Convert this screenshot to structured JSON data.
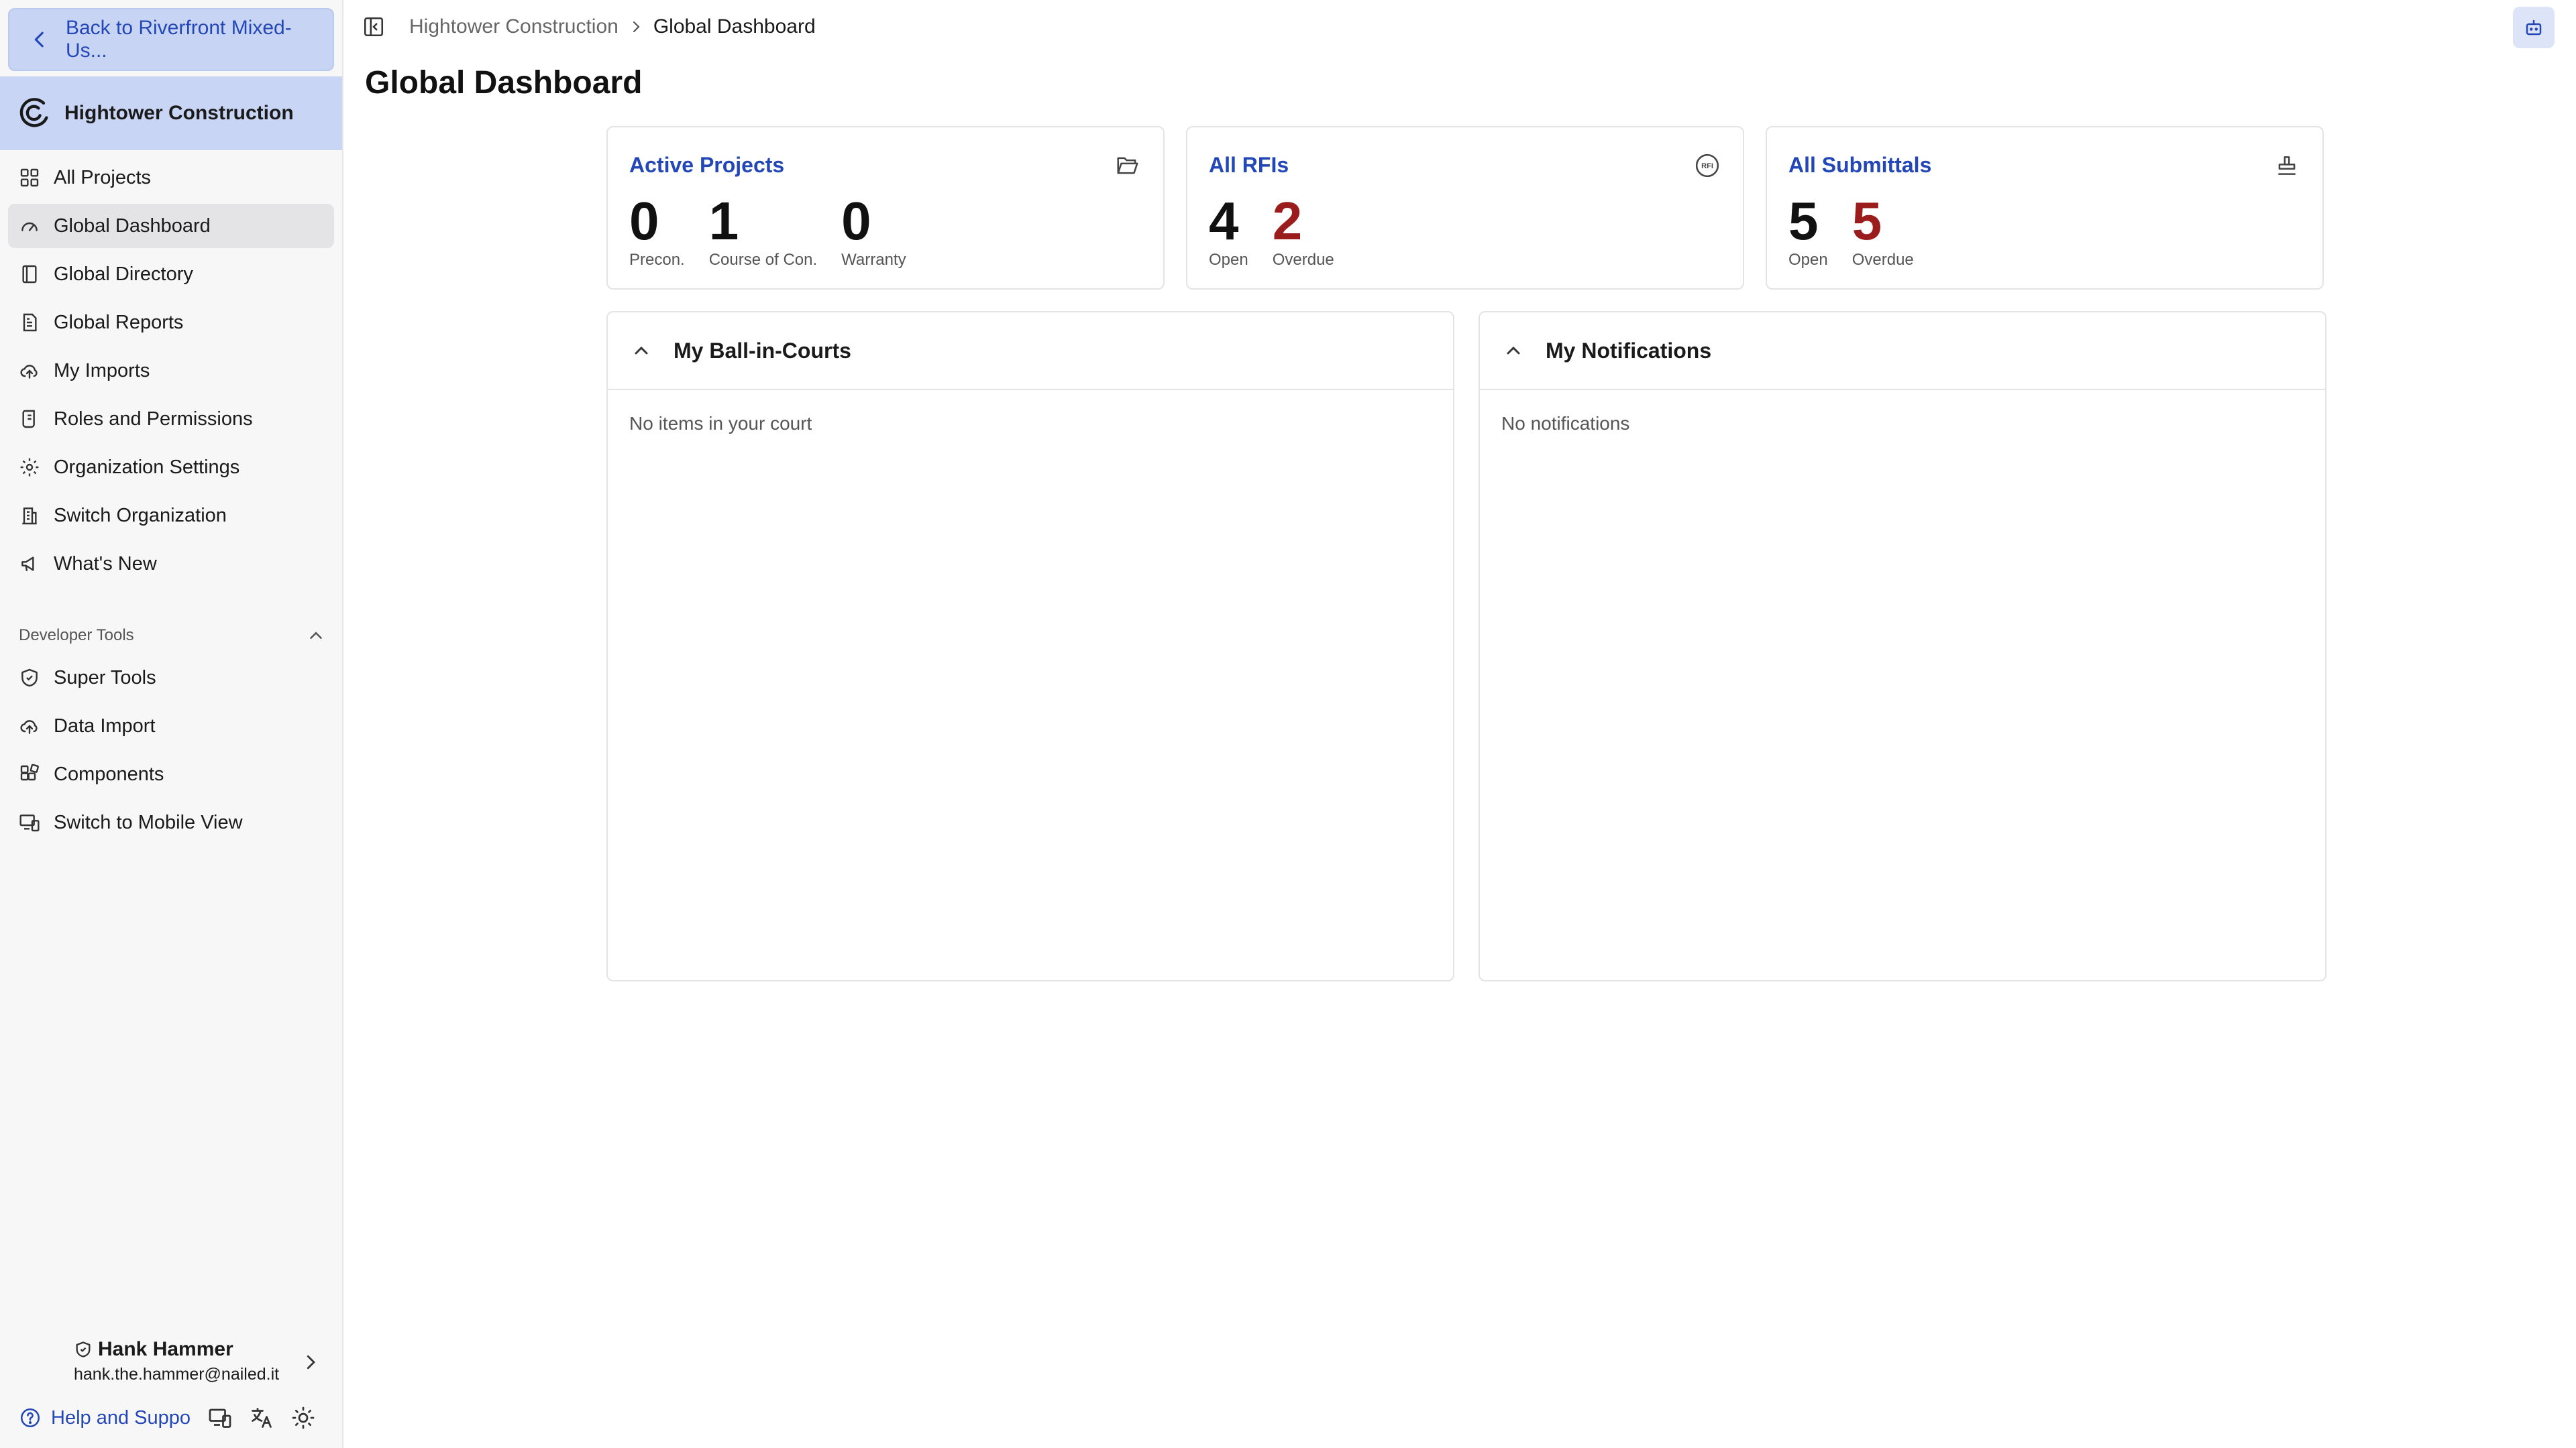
{
  "sidebar": {
    "back_label": "Back to Riverfront Mixed-Us...",
    "org_name": "Hightower Construction",
    "items": [
      {
        "label": "All Projects",
        "icon": "grid-icon"
      },
      {
        "label": "Global Dashboard",
        "icon": "gauge-icon",
        "active": true
      },
      {
        "label": "Global Directory",
        "icon": "book-icon"
      },
      {
        "label": "Global Reports",
        "icon": "report-icon"
      },
      {
        "label": "My Imports",
        "icon": "cloud-upload-icon"
      },
      {
        "label": "Roles and Permissions",
        "icon": "scroll-icon"
      },
      {
        "label": "Organization Settings",
        "icon": "gear-icon"
      },
      {
        "label": "Switch Organization",
        "icon": "building-icon"
      },
      {
        "label": "What's New",
        "icon": "megaphone-icon"
      }
    ],
    "dev_section_label": "Developer Tools",
    "dev_items": [
      {
        "label": "Super Tools",
        "icon": "shield-icon"
      },
      {
        "label": "Data Import",
        "icon": "cloud-upload-icon"
      },
      {
        "label": "Components",
        "icon": "components-icon"
      },
      {
        "label": "Switch to Mobile View",
        "icon": "devices-icon"
      }
    ],
    "user": {
      "name": "Hank Hammer",
      "email": "hank.the.hammer@nailed.it"
    },
    "help_label": "Help and Suppo"
  },
  "breadcrumb": {
    "org": "Hightower Construction",
    "current": "Global Dashboard"
  },
  "page_title": "Global Dashboard",
  "cards": {
    "active_projects": {
      "title": "Active Projects",
      "stats": [
        {
          "value": "0",
          "label": "Precon."
        },
        {
          "value": "1",
          "label": "Course of Con."
        },
        {
          "value": "0",
          "label": "Warranty"
        }
      ]
    },
    "rfis": {
      "title": "All RFIs",
      "stats": [
        {
          "value": "4",
          "label": "Open"
        },
        {
          "value": "2",
          "label": "Overdue"
        }
      ]
    },
    "submittals": {
      "title": "All Submittals",
      "stats": [
        {
          "value": "5",
          "label": "Open"
        },
        {
          "value": "5",
          "label": "Overdue"
        }
      ]
    }
  },
  "panels": {
    "ball_in_courts": {
      "title": "My Ball-in-Courts",
      "empty": "No items in your court"
    },
    "notifications": {
      "title": "My Notifications",
      "empty": "No notifications"
    }
  },
  "colors": {
    "accent": "#2447b8",
    "overdue": "#9b1c1c",
    "sidebar_bg": "#f7f7f8",
    "org_header_bg": "#c9d5f4"
  }
}
